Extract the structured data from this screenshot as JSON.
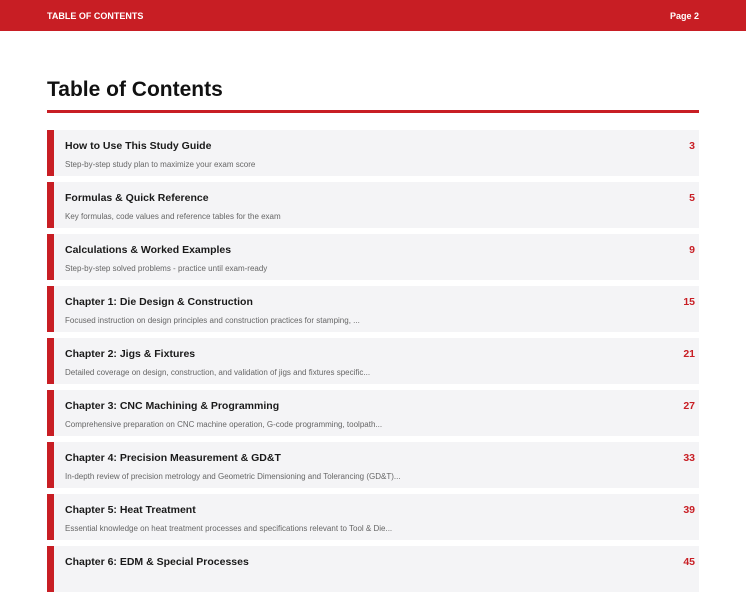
{
  "header": {
    "section": "TABLE OF CONTENTS",
    "page": "Page 2"
  },
  "title": "Table of Contents",
  "accent_color": "#c81e24",
  "entries": [
    {
      "title": "How to Use This Study Guide",
      "desc": "Step-by-step study plan to maximize your exam score",
      "page": "3"
    },
    {
      "title": "Formulas & Quick Reference",
      "desc": "Key formulas, code values and reference tables for the exam",
      "page": "5"
    },
    {
      "title": "Calculations & Worked Examples",
      "desc": "Step-by-step solved problems - practice until exam-ready",
      "page": "9"
    },
    {
      "title": "Chapter 1: Die Design & Construction",
      "desc": "Focused instruction on design principles and construction practices for stamping, ...",
      "page": "15"
    },
    {
      "title": "Chapter 2: Jigs & Fixtures",
      "desc": "Detailed coverage on design, construction, and validation of jigs and fixtures specific...",
      "page": "21"
    },
    {
      "title": "Chapter 3: CNC Machining & Programming",
      "desc": "Comprehensive preparation on CNC machine operation, G-code programming, toolpath...",
      "page": "27"
    },
    {
      "title": "Chapter 4: Precision Measurement & GD&T",
      "desc": "In-depth review of precision metrology and Geometric Dimensioning and Tolerancing (GD&T)...",
      "page": "33"
    },
    {
      "title": "Chapter 5: Heat Treatment",
      "desc": "Essential knowledge on heat treatment processes and specifications relevant to Tool & Die...",
      "page": "39"
    },
    {
      "title": "Chapter 6: EDM & Special Processes",
      "desc": "",
      "page": "45"
    }
  ]
}
